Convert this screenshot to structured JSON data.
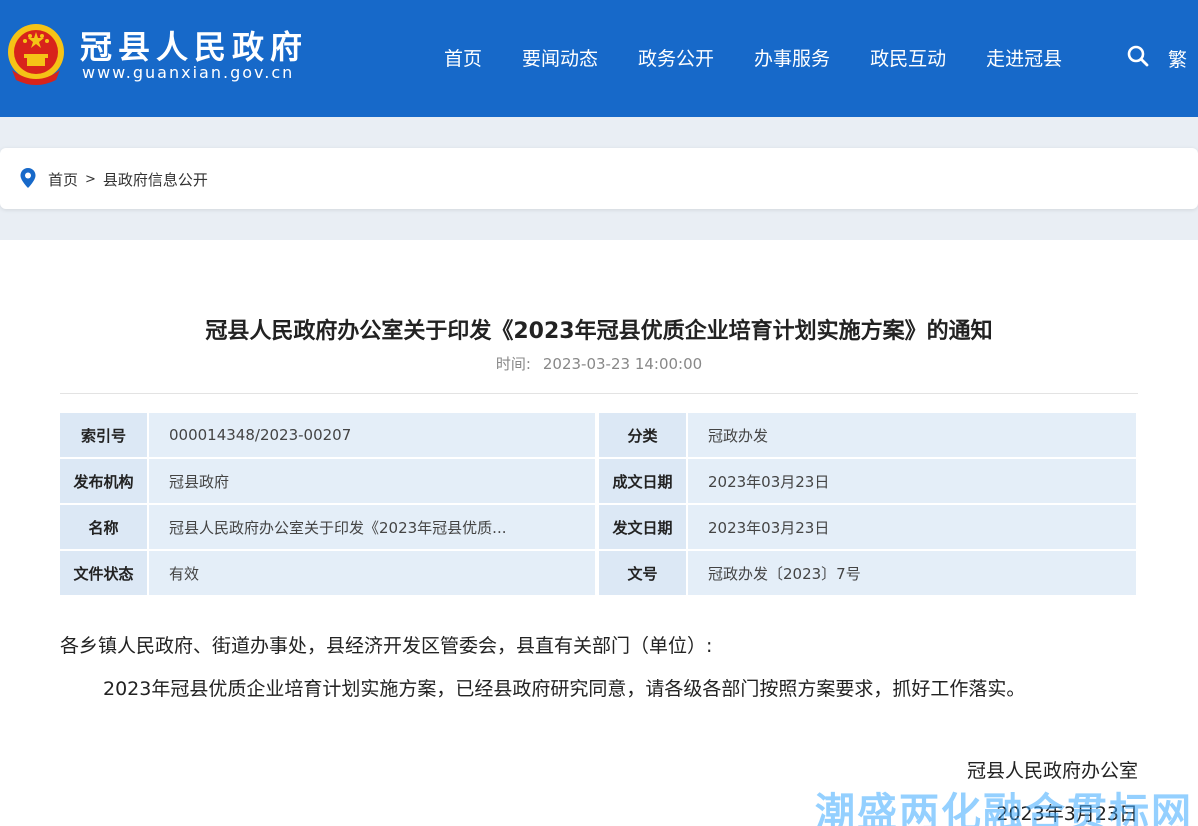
{
  "header": {
    "site_title": "冠县人民政府",
    "site_url": "www.guanxian.gov.cn",
    "nav": [
      "首页",
      "要闻动态",
      "政务公开",
      "办事服务",
      "政民互动",
      "走进冠县"
    ],
    "traditional_label": "繁",
    "brand_color": "#1769c9"
  },
  "breadcrumb": {
    "home": "首页",
    "separator": ">",
    "current": "县政府信息公开"
  },
  "article": {
    "title": "冠县人民政府办公室关于印发《2023年冠县优质企业培育计划实施方案》的通知",
    "time_label": "时间:",
    "time_value": "2023-03-23 14:00:00",
    "meta": [
      {
        "label1": "索引号",
        "value1": "000014348/2023-00207",
        "label2": "分类",
        "value2": "冠政办发"
      },
      {
        "label1": "发布机构",
        "value1": "冠县政府",
        "label2": "成文日期",
        "value2": "2023年03月23日"
      },
      {
        "label1": "名称",
        "value1": "冠县人民政府办公室关于印发《2023年冠县优质...",
        "label2": "发文日期",
        "value2": "2023年03月23日"
      },
      {
        "label1": "文件状态",
        "value1": "有效",
        "label2": "文号",
        "value2": "冠政办发〔2023〕7号"
      }
    ],
    "salutation": "各乡镇人民政府、街道办事处，县经济开发区管委会，县直有关部门（单位）:",
    "paragraph": "2023年冠县优质企业培育计划实施方案，已经县政府研究同意，请各级各部门按照方案要求，抓好工作落实。",
    "signature": "冠县人民政府办公室",
    "date": "2023年3月23日"
  },
  "watermark": "潮盛两化融合贯标网"
}
